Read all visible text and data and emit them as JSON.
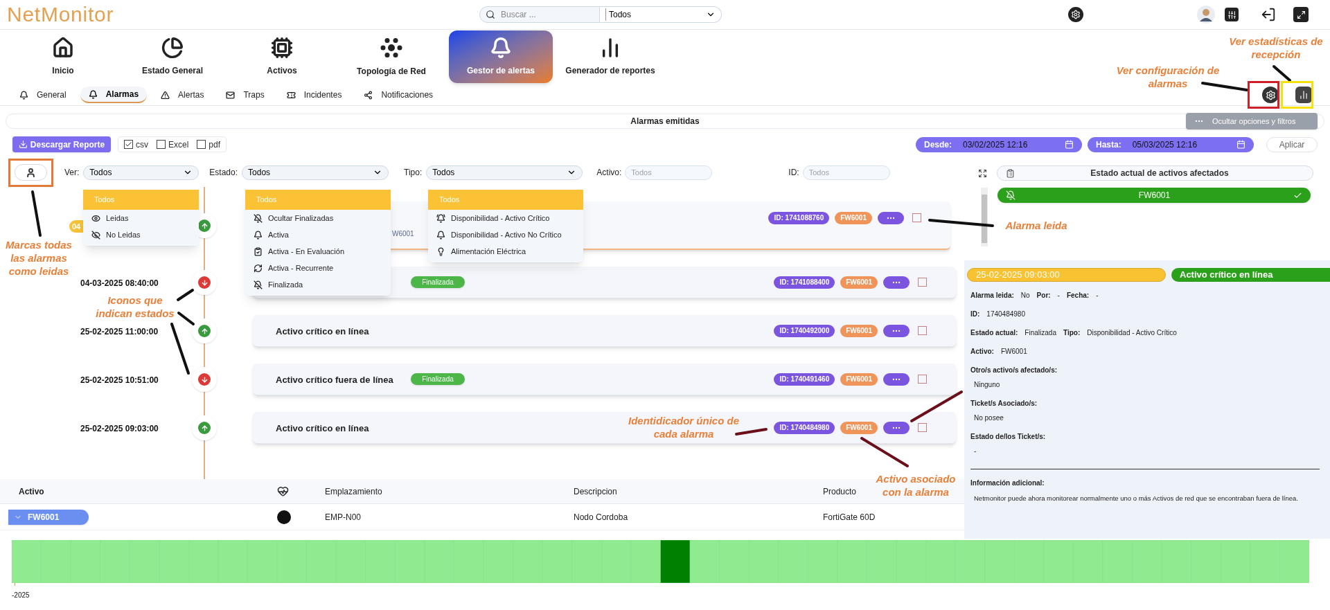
{
  "logo": "NetMonitor",
  "search": {
    "placeholder": "Buscar ...",
    "scope": "Todos"
  },
  "nav": [
    {
      "label": "Inicio",
      "selected": false
    },
    {
      "label": "Estado General",
      "selected": false
    },
    {
      "label": "Activos",
      "selected": false
    },
    {
      "label": "Topología de Red",
      "selected": false
    },
    {
      "label": "Gestor de alertas",
      "selected": true
    },
    {
      "label": "Generador de reportes",
      "selected": false
    }
  ],
  "subtabs": [
    {
      "label": "General",
      "selected": false
    },
    {
      "label": "Alarmas",
      "selected": true
    },
    {
      "label": "Alertas",
      "selected": false
    },
    {
      "label": "Traps",
      "selected": false
    },
    {
      "label": "Incidentes",
      "selected": false
    },
    {
      "label": "Notificaciones",
      "selected": false
    }
  ],
  "section_title": "Alarmas emitidas",
  "toggle_button": "Ocultar opciones y filtros",
  "download_button": "Descargar Reporte",
  "formats": [
    {
      "label": "csv",
      "checked": true
    },
    {
      "label": "Excel",
      "checked": false
    },
    {
      "label": "pdf",
      "checked": false
    }
  ],
  "date_from": {
    "label": "Desde:",
    "value": "03/02/2025 12:16"
  },
  "date_to": {
    "label": "Hasta:",
    "value": "05/03/2025 12:16"
  },
  "apply_button": "Aplicar",
  "filters": [
    {
      "kind": "select",
      "label": "Ver:",
      "value": "Todos",
      "open": true,
      "options": [
        {
          "label": "Todos",
          "selected": true
        },
        {
          "label": "Leidas",
          "selected": false
        },
        {
          "label": "No Leidas",
          "selected": false
        }
      ]
    },
    {
      "kind": "select",
      "label": "Estado:",
      "value": "Todos",
      "open": true,
      "options": [
        {
          "label": "Todos",
          "selected": true
        },
        {
          "label": "Ocultar Finalizadas",
          "selected": false
        },
        {
          "label": "Activa",
          "selected": false
        },
        {
          "label": "Activa - En Evaluación",
          "selected": false
        },
        {
          "label": "Activa - Recurrente",
          "selected": false
        },
        {
          "label": "Finalizada",
          "selected": false
        }
      ]
    },
    {
      "kind": "select",
      "label": "Tipo:",
      "value": "Todos",
      "open": true,
      "options": [
        {
          "label": "Todos",
          "selected": true
        },
        {
          "label": "Disponibilidad - Activo Crítico",
          "selected": false
        },
        {
          "label": "Disponibilidad - Activo No Crítico",
          "selected": false
        },
        {
          "label": "Alimentación Eléctrica",
          "selected": false
        }
      ]
    },
    {
      "kind": "input",
      "label": "Activo:",
      "placeholder": "Todos"
    },
    {
      "kind": "input",
      "label": "ID:",
      "placeholder": "Todos"
    }
  ],
  "alarms": [
    {
      "time": "04",
      "selected": true,
      "online": true,
      "subtitle": "W6001",
      "id": "ID: 1741088760",
      "asset": "FW6001",
      "read": false
    },
    {
      "time": "04-03-2025 08:40:00",
      "selected": false,
      "online": false,
      "badge": "Finalizada",
      "id": "ID: 1741088400",
      "asset": "FW6001",
      "read": false
    },
    {
      "time": "25-02-2025 11:00:00",
      "selected": false,
      "online": true,
      "title": "Activo crítico en línea",
      "id": "ID: 1740492000",
      "asset": "FW6001",
      "read": false
    },
    {
      "time": "25-02-2025 10:51:00",
      "selected": false,
      "online": false,
      "title": "Activo crítico fuera de línea",
      "badge": "Finalizada",
      "id": "ID: 1740491460",
      "asset": "FW6001",
      "read": false
    },
    {
      "time": "25-02-2025 09:03:00",
      "selected": false,
      "online": true,
      "title": "Activo crítico en línea",
      "id": "ID: 1740484980",
      "asset": "FW6001",
      "read": false
    }
  ],
  "assets_panel": {
    "title": "Estado actual de activos afectados",
    "items": [
      {
        "label": "FW6001",
        "ok": true
      }
    ]
  },
  "detail": {
    "date": "25-02-2025 09:03:00",
    "title": "Activo crítico en línea",
    "lines": [
      {
        "kind": "inline",
        "pairs": [
          {
            "label": "Alarma leida:",
            "value": "No"
          },
          {
            "label": "Por:",
            "value": "-"
          },
          {
            "label": "Fecha:",
            "value": "-"
          }
        ]
      },
      {
        "kind": "inline",
        "pairs": [
          {
            "label": "ID:",
            "value": "1740484980"
          }
        ]
      },
      {
        "kind": "inline",
        "pairs": [
          {
            "label": "Estado actual:",
            "value": "Finalizada"
          },
          {
            "label": "Tipo:",
            "value": "Disponibilidad - Activo Crítico"
          }
        ]
      },
      {
        "kind": "inline",
        "pairs": [
          {
            "label": "Activo:",
            "value": "FW6001"
          }
        ]
      },
      {
        "kind": "stacked",
        "label": "Otro/s activo/s afectado/s:",
        "value": "Ninguno"
      },
      {
        "kind": "stacked",
        "label": "Ticket/s Asociado/s:",
        "value": "No posee"
      },
      {
        "kind": "stacked",
        "label": "Estado de/los Ticket/s:",
        "value": "-"
      }
    ],
    "additional": {
      "label": "Información adicional:",
      "text": "Netmonitor puede ahora monitorear normalmente uno o más Activos de red que se encontraban fuera de línea."
    }
  },
  "table": {
    "columns": [
      "Activo",
      "Emplazamiento",
      "Descripcion",
      "Producto"
    ],
    "rows": [
      {
        "asset": "FW6001",
        "location": "EMP-N00",
        "description": "Nodo Cordoba",
        "product": "FortiGate 60D"
      }
    ]
  },
  "timeline_label": "-2025",
  "annotations": [
    {
      "text": "Ver estadísticas de recepción"
    },
    {
      "text": "Ver configuración de alarmas"
    },
    {
      "text": "Alarma leida"
    },
    {
      "text": "Marcas todas las alarmas como leidas"
    },
    {
      "text": "Iconos que indican estados"
    },
    {
      "text": "Identidicador único de cada alarma"
    },
    {
      "text": "Activo asociado con la alarma"
    }
  ]
}
